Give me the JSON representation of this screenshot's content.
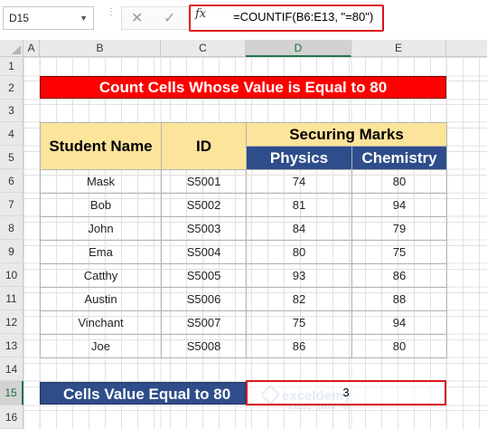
{
  "name_box": {
    "value": "D15"
  },
  "formula_bar": {
    "formula": "=COUNTIF(B6:E13, \"=80\")",
    "fx_label": "fx"
  },
  "columns": [
    "A",
    "B",
    "C",
    "D",
    "E"
  ],
  "rows": [
    "1",
    "2",
    "3",
    "4",
    "5",
    "6",
    "7",
    "8",
    "9",
    "10",
    "11",
    "12",
    "13",
    "14",
    "15",
    "16"
  ],
  "selected": {
    "column": "D",
    "row": "15"
  },
  "sheet": {
    "title": "Count Cells Whose Value is Equal to 80",
    "headers": {
      "student_name": "Student Name",
      "id": "ID",
      "securing_marks": "Securing Marks",
      "physics": "Physics",
      "chemistry": "Chemistry"
    },
    "students": [
      {
        "name": "Mask",
        "id": "S5001",
        "physics": "74",
        "chemistry": "80"
      },
      {
        "name": "Bob",
        "id": "S5002",
        "physics": "81",
        "chemistry": "94"
      },
      {
        "name": "John",
        "id": "S5003",
        "physics": "84",
        "chemistry": "79"
      },
      {
        "name": "Ema",
        "id": "S5004",
        "physics": "80",
        "chemistry": "75"
      },
      {
        "name": "Catthy",
        "id": "S5005",
        "physics": "93",
        "chemistry": "86"
      },
      {
        "name": "Austin",
        "id": "S5006",
        "physics": "82",
        "chemistry": "88"
      },
      {
        "name": "Vinchant",
        "id": "S5007",
        "physics": "75",
        "chemistry": "94"
      },
      {
        "name": "Joe",
        "id": "S5008",
        "physics": "86",
        "chemistry": "80"
      }
    ],
    "result_label": "Cells Value Equal to 80",
    "result_value": "3"
  },
  "watermark": {
    "brand": "exceldemy",
    "tagline": "EXCEL · DATA · BI"
  },
  "colors": {
    "title_bg": "#ff0000",
    "header_bg": "#fde49b",
    "subheader_bg": "#2e4d8a",
    "highlight": "#e0101a"
  }
}
